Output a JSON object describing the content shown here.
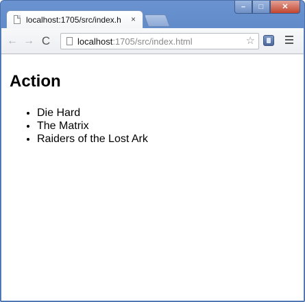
{
  "window": {
    "controls": {
      "minimize": "–",
      "maximize": "□",
      "close": "✕"
    }
  },
  "tab": {
    "title": "localhost:1705/src/index.h",
    "close": "×"
  },
  "toolbar": {
    "back": "←",
    "forward": "→",
    "reload": "C",
    "url_host": "localhost",
    "url_path": ":1705/src/index.html",
    "star": "☆",
    "icons": [
      "back-arrow-icon",
      "forward-arrow-icon",
      "reload-icon",
      "page-icon",
      "star-icon",
      "extension-icon",
      "menu-icon"
    ]
  },
  "page": {
    "heading": "Action",
    "items": [
      "Die Hard",
      "The Matrix",
      "Raiders of the Lost Ark"
    ]
  }
}
